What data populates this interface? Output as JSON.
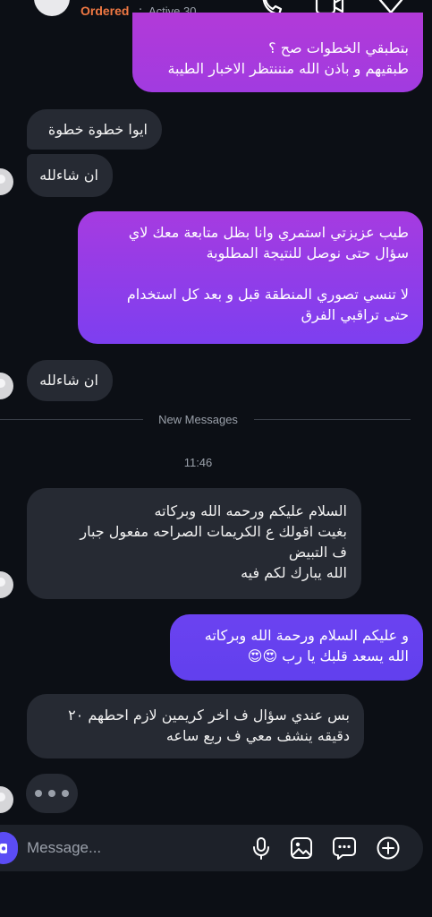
{
  "header": {
    "name": "Ordered",
    "separator": "·",
    "status": "Active 30..."
  },
  "messages": [
    {
      "id": "m1",
      "side": "out",
      "text": "بتطبقي الخطوات صح ؟\nطبقيهم و باذن الله منننتظر الاخبار الطيبة"
    },
    {
      "id": "m2",
      "side": "in",
      "text": "ايوا خطوة خطوة"
    },
    {
      "id": "m3",
      "side": "in",
      "text": "ان شاءلله"
    },
    {
      "id": "m4",
      "side": "out",
      "text": "طيب عزيزتي استمري وانا بظل متابعة معك لاي\nسؤال حتى نوصل للنتيجة المطلوبة\n\nلا تنسي تصوري المنطقة قبل و بعد كل استخدام\nحتى تراقبي الفرق"
    },
    {
      "id": "m5",
      "side": "in",
      "text": "ان شاءلله"
    },
    {
      "id": "m6",
      "side": "in",
      "text": "السلام عليكم ورحمه الله وبركاته\nبغيت اقولك ع الكريمات الصراحه مفعول جبار\nف التبيض\nالله يبارك لكم فيه"
    },
    {
      "id": "m7",
      "side": "out",
      "text": "و عليكم السلام ورحمة الله وبركاته\nالله يسعد قلبك يا رب 😍😍"
    },
    {
      "id": "m8",
      "side": "in",
      "text": "بس عندي سؤال ف اخر كريمين لازم احطهم ٢٠\nدقيقه ينشف معي ف ربع ساعه"
    }
  ],
  "divider": {
    "label": "New Messages"
  },
  "timestamp": "11:46",
  "composer": {
    "placeholder": "Message..."
  },
  "icons": {
    "header": [
      "phone-icon",
      "video-icon",
      "flag-icon"
    ],
    "composer": [
      "camera-icon",
      "microphone-icon",
      "gallery-icon",
      "sticker-icon",
      "plus-icon"
    ]
  },
  "colors": {
    "background": "#0c0f15",
    "incoming_bubble": "#262a33",
    "outgoing_gradient": [
      "#b13ad8",
      "#8a3cf0",
      "#6b40f0"
    ],
    "name_accent": "#f07843",
    "camera_button": "#5b4cf5"
  }
}
